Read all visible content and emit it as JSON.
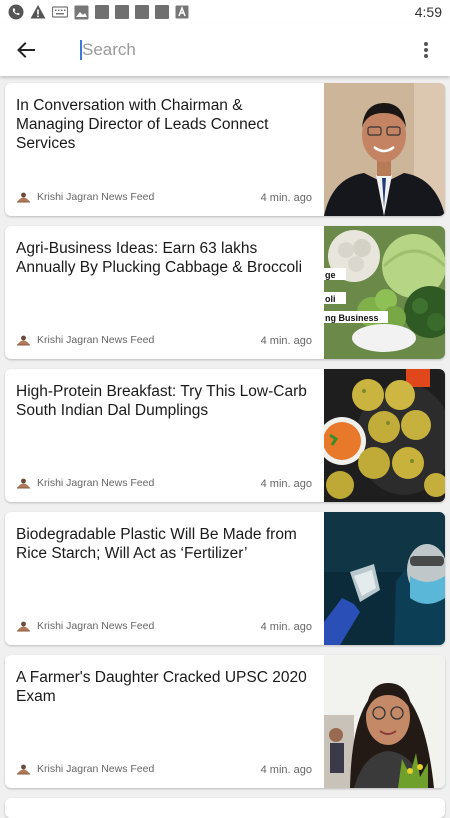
{
  "status": {
    "time": "4:59"
  },
  "search": {
    "placeholder": "Search",
    "value": ""
  },
  "feed": {
    "items": [
      {
        "title": "In Conversation with Chairman & Managing Director of Leads Connect Services",
        "source": "Krishi Jagran News Feed",
        "time": "4 min. ago",
        "thumb": "portrait-man-suit"
      },
      {
        "title": "Agri-Business Ideas: Earn 63 lakhs Annually By Plucking Cabbage & Broccoli",
        "source": "Krishi Jagran News Feed",
        "time": "4 min. ago",
        "thumb": "cabbage-broccoli",
        "thumb_text": [
          "ge",
          "oli",
          "ng Business"
        ]
      },
      {
        "title": "High-Protein Breakfast: Try This Low-Carb South Indian Dal Dumplings",
        "source": "Krishi Jagran News Feed",
        "time": "4 min. ago",
        "thumb": "dal-dumplings"
      },
      {
        "title": "Biodegradable Plastic Will Be Made from Rice Starch; Will Act as ‘Fertilizer’",
        "source": "Krishi Jagran News Feed",
        "time": "4 min. ago",
        "thumb": "lab-scientist"
      },
      {
        "title": "A Farmer's Daughter Cracked UPSC 2020 Exam",
        "source": "Krishi Jagran News Feed",
        "time": "4 min. ago",
        "thumb": "portrait-woman"
      }
    ]
  }
}
